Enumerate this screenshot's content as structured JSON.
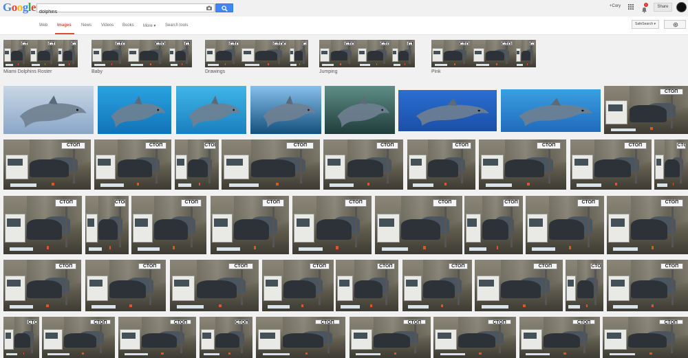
{
  "header": {
    "logo": [
      "G",
      "o",
      "o",
      "g",
      "l",
      "e"
    ],
    "search_value": "dolphins",
    "user_label": "+Cory",
    "notification_count": "1",
    "share_label": "Share"
  },
  "nav": {
    "tabs": [
      "Web",
      "Images",
      "News",
      "Videos",
      "Books",
      "More ▾",
      "Search tools"
    ],
    "active_tab": "Images",
    "safesearch_label": "SafeSearch ▾"
  },
  "related": [
    {
      "label": "Miami Dolphins Roster"
    },
    {
      "label": "Baby"
    },
    {
      "label": "Drawings"
    },
    {
      "label": "Jumping"
    },
    {
      "label": "Pink"
    }
  ],
  "results": {
    "dolphin_images": 7,
    "sign_text": "СТОП"
  },
  "colors": {
    "accent_red": "#dd4b39",
    "search_blue": "#4285f4"
  }
}
